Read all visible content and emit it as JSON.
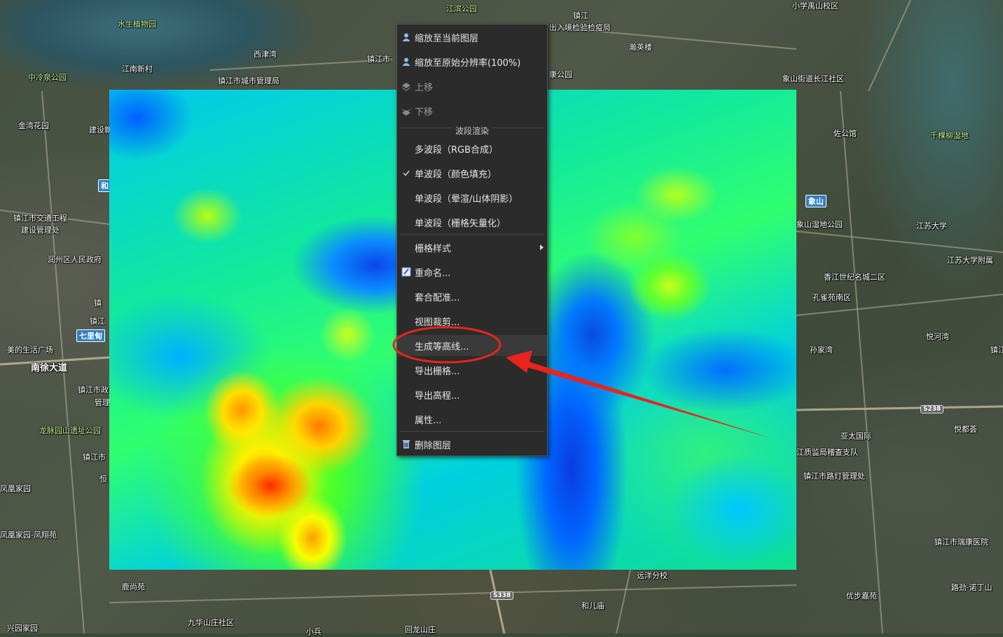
{
  "map": {
    "labels": [
      {
        "text": "江滨公园",
        "green": true
      },
      {
        "text": "镇江"
      },
      {
        "text": "出入境检验检疫局"
      },
      {
        "text": "小学禹山校区"
      },
      {
        "text": "水生植物园",
        "green": true
      },
      {
        "text": "西津湾"
      },
      {
        "text": "镇江市"
      },
      {
        "text": "中冷泉公园",
        "green": true
      },
      {
        "text": "江南新村"
      },
      {
        "text": "镇江市城市管理局"
      },
      {
        "text": "瀚英楼"
      },
      {
        "text": "康公园"
      },
      {
        "text": "象山街道长江社区"
      },
      {
        "text": "金湾花园"
      },
      {
        "text": "建设新"
      },
      {
        "text": "佐公馆"
      },
      {
        "text": "千棵柳湿地",
        "green": true
      },
      {
        "text": "镇江市交通工程"
      },
      {
        "text": "建设管理处"
      },
      {
        "text": "象山湿地公园"
      },
      {
        "text": "江苏大学"
      },
      {
        "text": "润州区人民政府"
      },
      {
        "text": "江苏大学附属"
      },
      {
        "text": "香江世纪名城二区"
      },
      {
        "text": "孔雀苑南区"
      },
      {
        "text": "镇"
      },
      {
        "text": "镇江"
      },
      {
        "text": "悦河湾"
      },
      {
        "text": "美的生活广场"
      },
      {
        "text": "孙家湾"
      },
      {
        "text": "镇江"
      },
      {
        "text": "镇江市政"
      },
      {
        "text": "管理"
      },
      {
        "text": "龙脉园山遗址公园",
        "green": true
      },
      {
        "text": "悦都荟"
      },
      {
        "text": "亚太国际"
      },
      {
        "text": "江质监局稽查支队"
      },
      {
        "text": "镇江市"
      },
      {
        "text": "镇江市路灯管理处"
      },
      {
        "text": "恒"
      },
      {
        "text": "凤凰家园"
      },
      {
        "text": "凤凰家园-凤翔苑"
      },
      {
        "text": "镇江市瑞康医院"
      },
      {
        "text": "远洋分校"
      },
      {
        "text": "鹿尚苑"
      },
      {
        "text": "路劲·诺丁山"
      },
      {
        "text": "和儿庙"
      },
      {
        "text": "优步嘉苑"
      },
      {
        "text": "九华山庄社区"
      },
      {
        "text": "兴园家园"
      },
      {
        "text": "小兵"
      },
      {
        "text": "回龙山庄"
      }
    ],
    "road_labels": [
      "和",
      "七里甸",
      "象山",
      "南徐大道",
      "S238",
      "S338"
    ]
  },
  "context_menu": {
    "items": [
      {
        "label": "缩放至当前图层",
        "icon": "user-icon",
        "disabled": false
      },
      {
        "label": "缩放至原始分辨率(100%)",
        "icon": "user-icon",
        "disabled": false
      },
      {
        "label": "上移",
        "icon": "layers-up-icon",
        "disabled": true
      },
      {
        "label": "下移",
        "icon": "layers-down-icon",
        "disabled": true
      }
    ],
    "group_title": "波段渲染",
    "band_items": [
      {
        "label": "多波段（RGB合成）",
        "checked": false
      },
      {
        "label": "单波段（颜色填充）",
        "checked": true
      },
      {
        "label": "单波段（晕渲/山体阴影）",
        "checked": false
      },
      {
        "label": "单波段（栅格矢量化）",
        "checked": false
      }
    ],
    "more_items": [
      {
        "label": "栅格样式",
        "submenu": true
      },
      {
        "label": "重命名...",
        "icon": "rename-icon"
      },
      {
        "label": "套合配准..."
      },
      {
        "label": "视图裁剪..."
      },
      {
        "label": "生成等高线...",
        "highlighted": true
      },
      {
        "label": "导出栅格..."
      },
      {
        "label": "导出高程..."
      },
      {
        "label": "属性..."
      }
    ],
    "delete_item": {
      "label": "删除图层",
      "icon": "trash-icon"
    }
  },
  "annotation_color": "#e8241c"
}
